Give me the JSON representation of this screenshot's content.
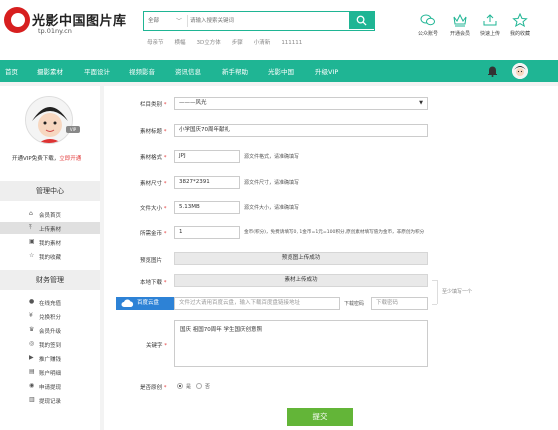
{
  "header": {
    "logo_title": "光影中国图片库",
    "logo_sub": "tp.01ny.cn",
    "search": {
      "category": "全部",
      "placeholder": "请输入搜索关键词"
    },
    "hot_words": [
      "母亲节",
      "横幅",
      "3D立方体",
      "步骤",
      "小清新",
      "111111"
    ],
    "top_icons": [
      {
        "label": "公众账号",
        "icon": "wechat-icon"
      },
      {
        "label": "开通会员",
        "icon": "crown-icon"
      },
      {
        "label": "快速上传",
        "icon": "upload-icon"
      },
      {
        "label": "我的收藏",
        "icon": "star-icon"
      }
    ]
  },
  "nav": {
    "items": [
      "首页",
      "摄影素材",
      "平面设计",
      "视频影音",
      "资讯信息",
      "新手帮助",
      "光影中国",
      "升级VIP"
    ],
    "accent": "#1fb594"
  },
  "sidebar": {
    "vip_text": "开通VIP免费下载，",
    "vip_link": "立即开通",
    "badge": "VIP",
    "section1_title": "管理中心",
    "section1_items": [
      {
        "label": "会员首页",
        "icon": "home-icon"
      },
      {
        "label": "上传素材",
        "icon": "upload-icon"
      },
      {
        "label": "我的素材",
        "icon": "image-icon"
      },
      {
        "label": "我的收藏",
        "icon": "star-icon"
      }
    ],
    "section2_title": "财务管理",
    "section2_items": [
      {
        "label": "在线充值",
        "icon": "coin-icon"
      },
      {
        "label": "兑换积分",
        "icon": "exchange-icon"
      },
      {
        "label": "会员升级",
        "icon": "crown-icon"
      },
      {
        "label": "我的签到",
        "icon": "checkin-icon"
      },
      {
        "label": "推广赚钱",
        "icon": "promote-icon"
      },
      {
        "label": "账户明细",
        "icon": "list-icon"
      },
      {
        "label": "申请提现",
        "icon": "withdraw-icon"
      },
      {
        "label": "提现记录",
        "icon": "record-icon"
      }
    ]
  },
  "form": {
    "category": {
      "label": "栏目类别",
      "value": "———风光"
    },
    "title": {
      "label": "素材标题",
      "value": "小学国庆70周年献礼"
    },
    "format": {
      "label": "素材格式",
      "value": "JPJ",
      "hint": "源文件格式，请准确填写"
    },
    "size": {
      "label": "素材尺寸",
      "value": "3827*2391",
      "hint": "源文件尺寸，请准确填写"
    },
    "filesize": {
      "label": "文件大小",
      "value": "5.13MB",
      "hint": "源文件大小，请准确填写"
    },
    "coins": {
      "label": "所需金币",
      "value": "1",
      "hint": "金币(积分)，免费请填写0, 1金币=1元=100积分,原创素材填写值为金币，非原创为积分"
    },
    "preview": {
      "label": "预览图片",
      "button": "预览图上传成功"
    },
    "download": {
      "label": "本地下载",
      "button": "素材上传成功",
      "aside": "至少填写一个"
    },
    "baidu": {
      "button": "百度云盘",
      "placeholder": "文件过大请用百度云盘，输入下载百度盘链接地址",
      "code_label": "下载密码",
      "code_placeholder": "下载密码"
    },
    "keywords": {
      "label": "关键字",
      "value": "国庆  祖国70周年  学生国庆创意照"
    },
    "original": {
      "label": "是否原创",
      "yes": "是",
      "no": "否"
    },
    "submit": "提交"
  }
}
